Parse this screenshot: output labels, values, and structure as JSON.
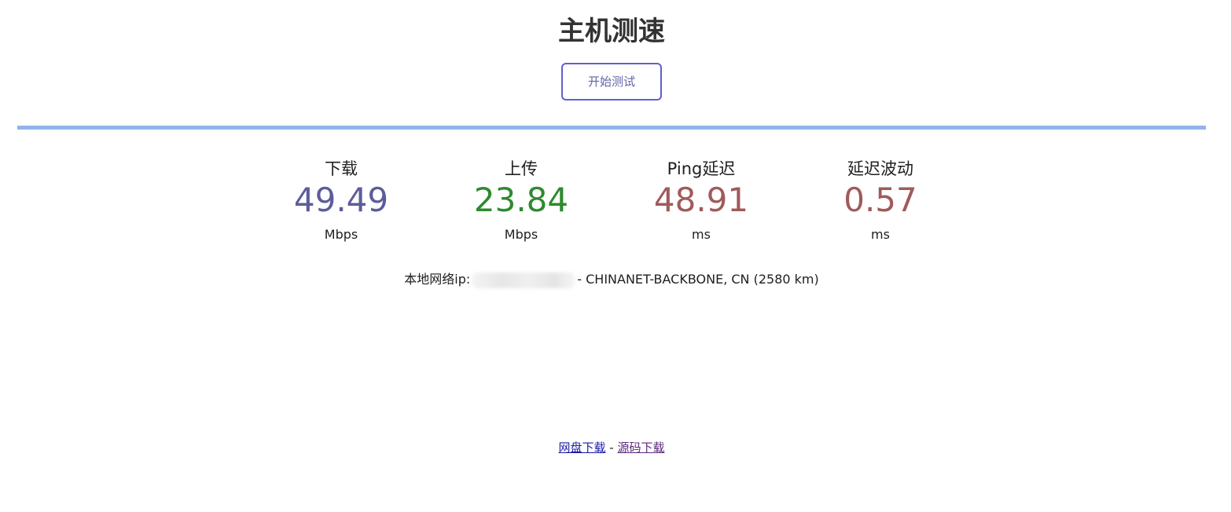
{
  "header": {
    "title": "主机测速",
    "start_button_label": "开始测试"
  },
  "progress": {
    "fraction": 1.0,
    "color": "#8fb4e8"
  },
  "metrics": [
    {
      "label": "下载",
      "value": "49.49",
      "unit": "Mbps",
      "color": "#5c5c9c"
    },
    {
      "label": "上传",
      "value": "23.84",
      "unit": "Mbps",
      "color": "#2e8a2e"
    },
    {
      "label": "Ping延迟",
      "value": "48.91",
      "unit": "ms",
      "color": "#a05a5a"
    },
    {
      "label": "延迟波动",
      "value": "0.57",
      "unit": "ms",
      "color": "#a05a5a"
    }
  ],
  "ip_info": {
    "prefix": "本地网络ip:",
    "suffix": "- CHINANET-BACKBONE, CN (2580 km)"
  },
  "footer": {
    "link_pan": "网盘下载",
    "separator": " - ",
    "link_src": "源码下载"
  }
}
